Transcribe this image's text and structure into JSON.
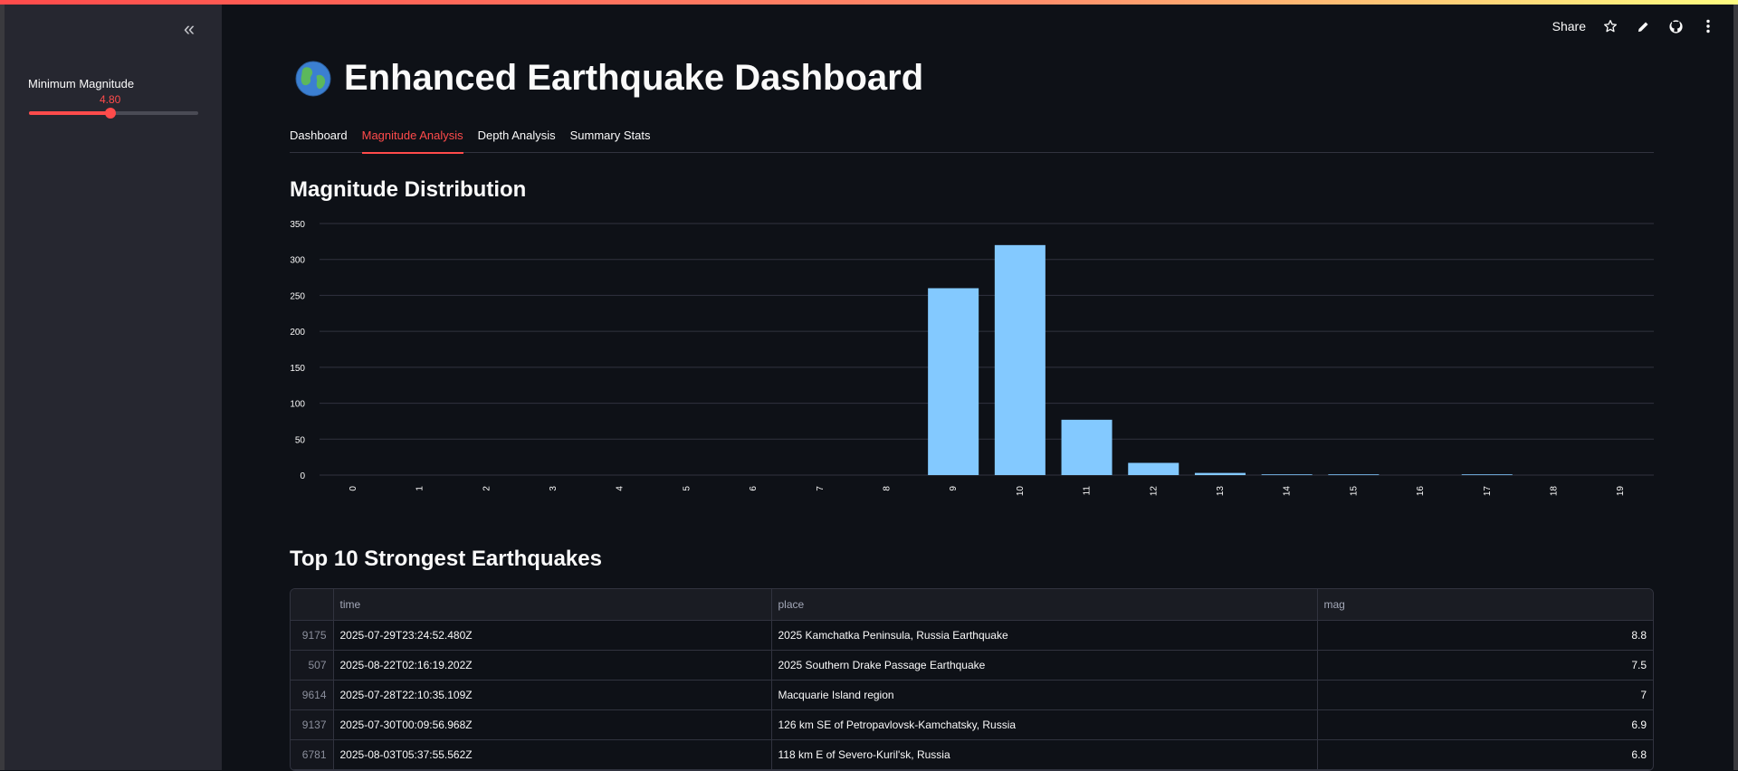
{
  "sidebar": {
    "slider": {
      "label": "Minimum Magnitude",
      "value": "4.80",
      "min": 0,
      "max": 10,
      "current": 4.8
    }
  },
  "toolbar": {
    "share_label": "Share"
  },
  "header": {
    "title": "Enhanced Earthquake Dashboard"
  },
  "tabs": [
    {
      "label": "Dashboard",
      "active": false
    },
    {
      "label": "Magnitude Analysis",
      "active": true
    },
    {
      "label": "Depth Analysis",
      "active": false
    },
    {
      "label": "Summary Stats",
      "active": false
    }
  ],
  "section1_title": "Magnitude Distribution",
  "chart_data": {
    "type": "bar",
    "categories": [
      "0",
      "1",
      "2",
      "3",
      "4",
      "5",
      "6",
      "7",
      "8",
      "9",
      "10",
      "11",
      "12",
      "13",
      "14",
      "15",
      "16",
      "17",
      "18",
      "19"
    ],
    "values": [
      0,
      0,
      0,
      0,
      0,
      0,
      0,
      0,
      0,
      260,
      320,
      77,
      17,
      3,
      1,
      1,
      0,
      1,
      0,
      0
    ],
    "ylim": [
      0,
      350
    ],
    "yticks": [
      0,
      50,
      100,
      150,
      200,
      250,
      300,
      350
    ],
    "grid": true,
    "bar_color": "#83c9ff",
    "title": "",
    "xlabel": "",
    "ylabel": ""
  },
  "section2_title": "Top 10 Strongest Earthquakes",
  "table": {
    "columns": [
      "time",
      "place",
      "mag"
    ],
    "rows": [
      {
        "index": "9175",
        "time": "2025-07-29T23:24:52.480Z",
        "place": "2025 Kamchatka Peninsula, Russia Earthquake",
        "mag": "8.8"
      },
      {
        "index": "507",
        "time": "2025-08-22T02:16:19.202Z",
        "place": "2025 Southern Drake Passage Earthquake",
        "mag": "7.5"
      },
      {
        "index": "9614",
        "time": "2025-07-28T22:10:35.109Z",
        "place": "Macquarie Island region",
        "mag": "7"
      },
      {
        "index": "9137",
        "time": "2025-07-30T00:09:56.968Z",
        "place": "126 km SE of Petropavlovsk-Kamchatsky, Russia",
        "mag": "6.9"
      },
      {
        "index": "6781",
        "time": "2025-08-03T05:37:55.562Z",
        "place": "118 km E of Severo-Kuril'sk, Russia",
        "mag": "6.8"
      }
    ]
  },
  "colors": {
    "accent": "#ff4b4b",
    "background": "#0e1117",
    "sidebar": "#262730"
  }
}
